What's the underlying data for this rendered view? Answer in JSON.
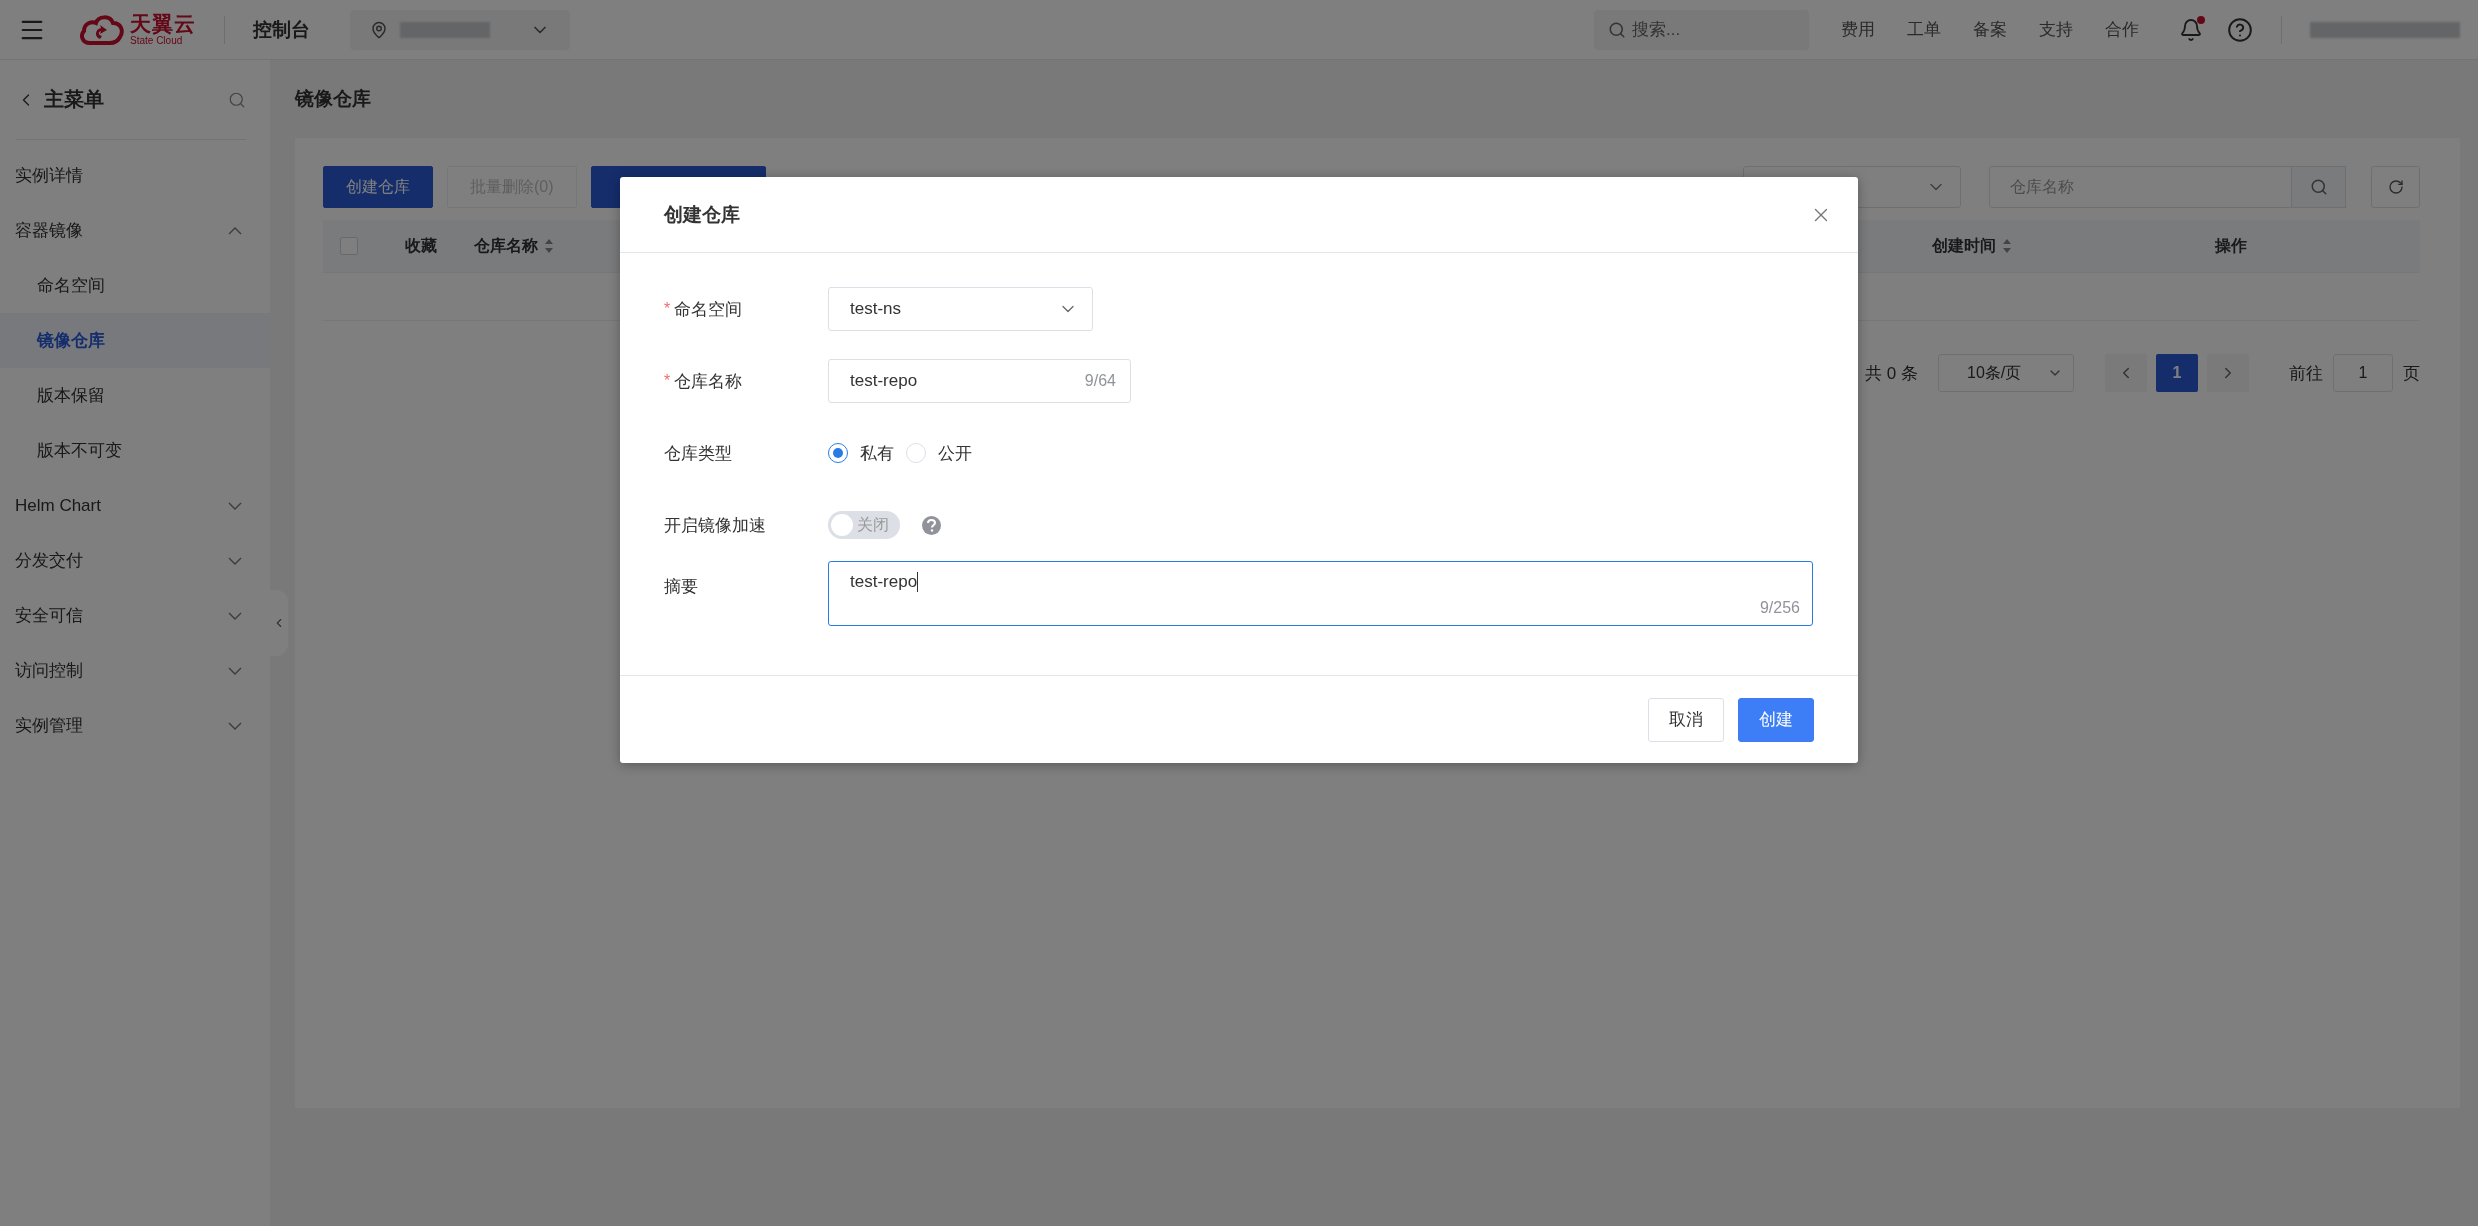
{
  "top_bar": {
    "logo": {
      "name": "天翼云",
      "subtitle": "State Cloud"
    },
    "console_label": "控制台",
    "search": {
      "placeholder": "搜索..."
    },
    "links": [
      "费用",
      "工单",
      "备案",
      "支持",
      "合作"
    ],
    "notifications": {
      "unread": true
    }
  },
  "sidebar": {
    "title": "主菜单",
    "items": [
      {
        "kind": "link",
        "label": "实例详情",
        "selected": false
      },
      {
        "kind": "group",
        "label": "容器镜像",
        "selected": false,
        "expanded": true,
        "children": [
          {
            "label": "命名空间",
            "selected": false
          },
          {
            "label": "镜像仓库",
            "selected": true
          },
          {
            "label": "版本保留",
            "selected": false
          },
          {
            "label": "版本不可变",
            "selected": false
          }
        ]
      },
      {
        "kind": "group",
        "label": "Helm Chart",
        "selected": false,
        "expanded": false
      },
      {
        "kind": "group",
        "label": "分发交付",
        "selected": false,
        "expanded": false
      },
      {
        "kind": "group",
        "label": "安全可信",
        "selected": false,
        "expanded": false
      },
      {
        "kind": "group",
        "label": "访问控制",
        "selected": false,
        "expanded": false
      },
      {
        "kind": "group",
        "label": "实例管理",
        "selected": false,
        "expanded": false
      }
    ]
  },
  "page": {
    "title": "镜像仓库",
    "toolbar": {
      "buttons": [
        {
          "label": "创建仓库",
          "kind": "primary",
          "disabled": false
        },
        {
          "label": "批量删除(0)",
          "kind": "default",
          "disabled": true
        },
        {
          "kind": "primary",
          "disabled": false
        }
      ],
      "search": {
        "placeholder": "仓库名称"
      }
    },
    "table": {
      "select_all": {
        "checked": false
      },
      "columns": [
        {
          "label": "收藏",
          "sortable": false
        },
        {
          "label": "仓库名称",
          "sortable": true
        },
        {
          "label": "创建时间",
          "sortable": true
        },
        {
          "label": "操作",
          "sortable": false
        }
      ]
    },
    "pagination": {
      "total": "共 0 条",
      "page_size": "10条/页",
      "pages": [
        {
          "label": "1",
          "selected": true
        }
      ],
      "goto_label": "前往",
      "goto_value": "1",
      "page_suffix": "页"
    }
  },
  "dialog": {
    "title": "创建仓库",
    "fields": [
      {
        "kind": "select",
        "label": "命名空间",
        "required_mark": "*",
        "value": "test-ns"
      },
      {
        "kind": "input",
        "label": "仓库名称",
        "required_mark": "*",
        "value": "test-repo",
        "counter": "9/64"
      },
      {
        "kind": "radio",
        "label": "仓库类型",
        "options": [
          {
            "label": "私有",
            "selected": true
          },
          {
            "label": "公开",
            "selected": false
          }
        ]
      },
      {
        "kind": "switch",
        "label": "开启镜像加速",
        "on": false,
        "state_text": "关闭",
        "help": true
      },
      {
        "kind": "textarea",
        "label": "摘要",
        "value": "test-repo",
        "counter": "9/256",
        "focused": true
      }
    ],
    "buttons": [
      {
        "label": "取消",
        "kind": "default"
      },
      {
        "label": "创建",
        "kind": "primary"
      }
    ]
  }
}
